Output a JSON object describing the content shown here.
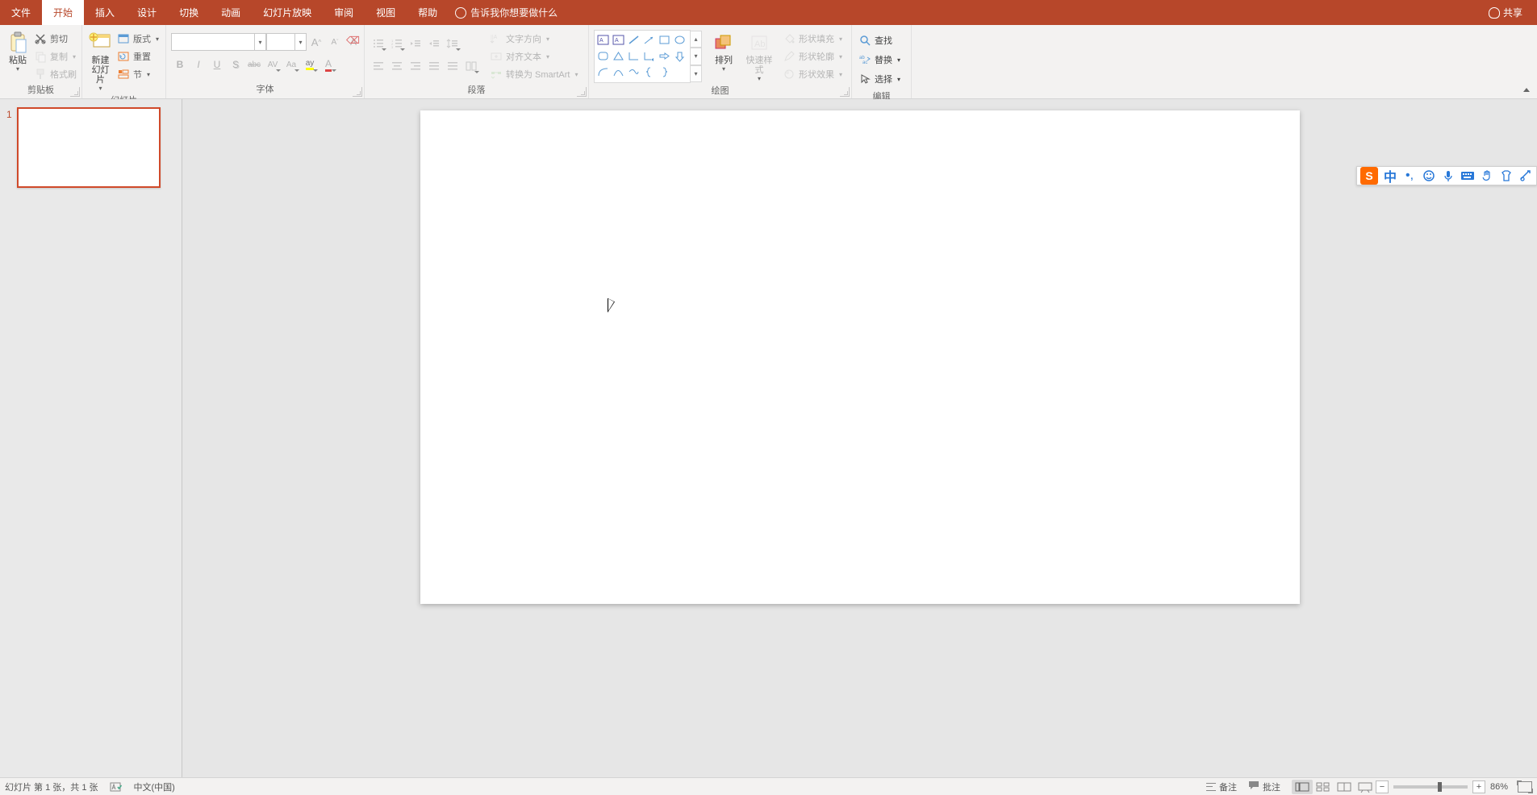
{
  "menubar": {
    "tabs": [
      "文件",
      "开始",
      "插入",
      "设计",
      "切换",
      "动画",
      "幻灯片放映",
      "审阅",
      "视图",
      "帮助"
    ],
    "active_index": 1,
    "tellme": "告诉我你想要做什么",
    "share": "共享"
  },
  "ribbon": {
    "clipboard": {
      "paste": "粘贴",
      "cut": "剪切",
      "copy": "复制",
      "format_painter": "格式刷",
      "label": "剪贴板"
    },
    "slides": {
      "new_slide": "新建\n幻灯片",
      "layout": "版式",
      "reset": "重置",
      "section": "节",
      "label": "幻灯片"
    },
    "font": {
      "name": "",
      "size": "",
      "grow": "A",
      "shrink": "A",
      "clear": "A",
      "bold": "B",
      "italic": "I",
      "underline": "U",
      "shadow": "S",
      "strike": "abc",
      "spacing": "AV",
      "case": "Aa",
      "highlight": "ay",
      "color": "A",
      "label": "字体"
    },
    "paragraph": {
      "text_direction": "文字方向",
      "align_text": "对齐文本",
      "convert_smartart": "转换为 SmartArt",
      "label": "段落"
    },
    "drawing": {
      "arrange": "排列",
      "quick_styles": "快速样式",
      "shape_fill": "形状填充",
      "shape_outline": "形状轮廓",
      "shape_effects": "形状效果",
      "label": "绘图"
    },
    "editing": {
      "find": "查找",
      "replace": "替换",
      "select": "选择",
      "label": "编辑"
    }
  },
  "thumb": {
    "number": "1"
  },
  "status": {
    "slide_info": "幻灯片 第 1 张，共 1 张",
    "language": "中文(中国)",
    "notes": "备注",
    "comments": "批注",
    "zoom": "86%"
  },
  "ime": {
    "mode": "中"
  }
}
